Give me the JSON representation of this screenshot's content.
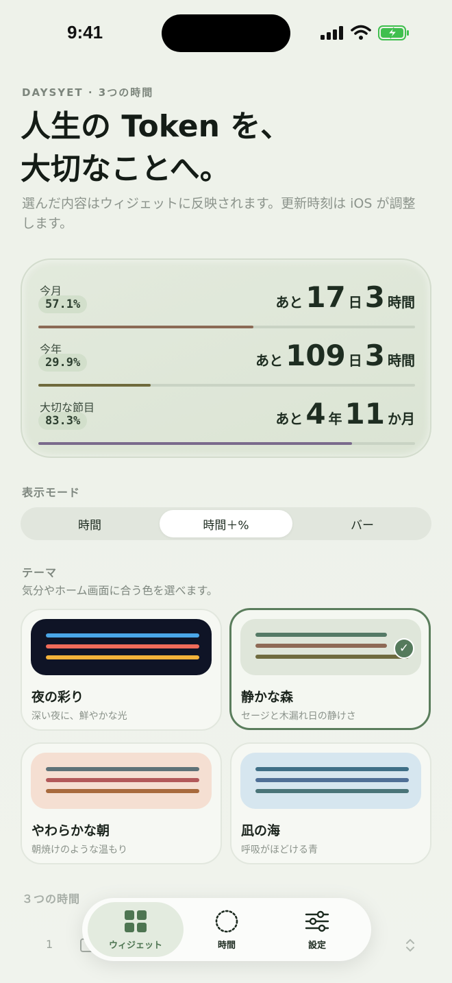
{
  "status": {
    "time": "9:41"
  },
  "header": {
    "eyebrow": "DAYSYET · 3つの時間",
    "title_line1": "人生の Token を、",
    "title_line2": "大切なことへ。",
    "subtitle": "選んだ内容はウィジェットに反映されます。更新時刻は iOS が調整します。"
  },
  "preview": {
    "rows": [
      {
        "label": "今月",
        "percent": "57.1%",
        "progress": 0.571,
        "prefix": "あと",
        "n1": "17",
        "u1": "日",
        "n2": "3",
        "u2": "時間",
        "color": "#8b6a55"
      },
      {
        "label": "今年",
        "percent": "29.9%",
        "progress": 0.299,
        "prefix": "あと",
        "n1": "109",
        "u1": "日",
        "n2": "3",
        "u2": "時間",
        "color": "#6f6a3c"
      },
      {
        "label": "大切な節目",
        "percent": "83.3%",
        "progress": 0.833,
        "prefix": "あと",
        "n1": "4",
        "u1": "年",
        "n2": "11",
        "u2": "か月",
        "color": "#7a6a8c"
      }
    ]
  },
  "display_mode": {
    "label": "表示モード",
    "options": [
      "時間",
      "時間＋%",
      "バー"
    ],
    "selected": "時間＋%"
  },
  "theme": {
    "label": "テーマ",
    "hint": "気分やホーム画面に合う色を選べます。",
    "cards": [
      {
        "name": "夜の彩り",
        "desc": "深い夜に、鮮やかな光",
        "bg": "#0f1426",
        "lines": [
          "#4aa6e8",
          "#ef6b5a",
          "#f2b23a"
        ],
        "selected": false
      },
      {
        "name": "静かな森",
        "desc": "セージと木漏れ日の静けさ",
        "bg": "#dfe6da",
        "lines": [
          "#557a66",
          "#8e6a56",
          "#6f6b3f"
        ],
        "selected": true
      },
      {
        "name": "やわらかな朝",
        "desc": "朝焼けのような温もり",
        "bg": "#f5dfd2",
        "lines": [
          "#5e7278",
          "#b2595a",
          "#a86a3d"
        ],
        "selected": false
      },
      {
        "name": "凪の海",
        "desc": "呼吸がほどける青",
        "bg": "#d6e6ef",
        "lines": [
          "#3f6f86",
          "#4f6f96",
          "#4a7478"
        ],
        "selected": false
      }
    ]
  },
  "three_times": {
    "label": "３つの時間",
    "row_number": "1"
  },
  "tabbar": {
    "tabs": [
      {
        "label": "ウィジェット",
        "icon": "widget-grid-icon",
        "active": true
      },
      {
        "label": "時間",
        "icon": "dotted-circle-icon",
        "active": false
      },
      {
        "label": "設定",
        "icon": "sliders-icon",
        "active": false
      }
    ]
  }
}
